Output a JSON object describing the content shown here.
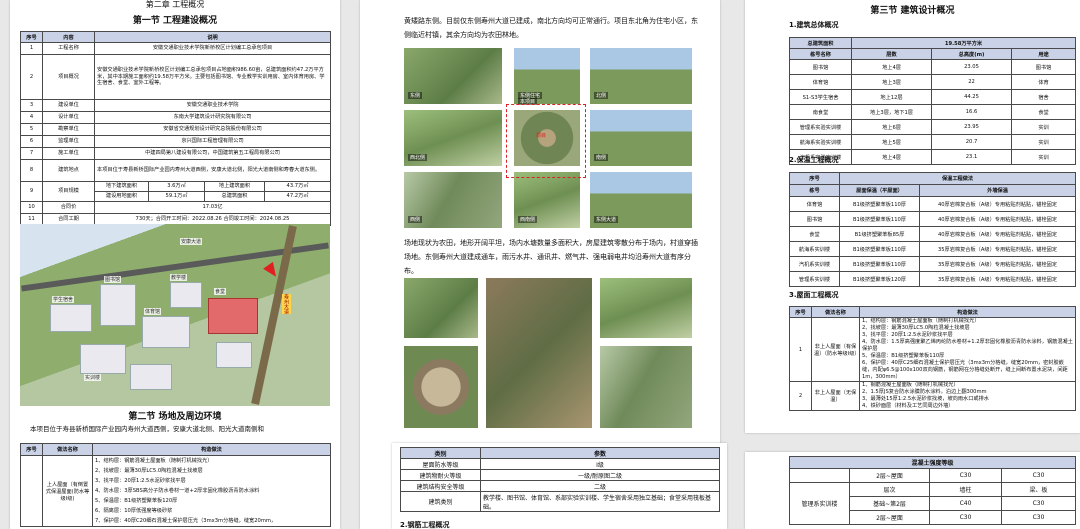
{
  "p1": {
    "chapter": "第二章 工程概况",
    "section1": "第一节 工程建设概况",
    "table_headers": [
      "序号",
      "内容",
      "说明"
    ],
    "rows": [
      [
        "1",
        "工程名称",
        "安徽交通职业技术学院新桥校区计划编工总承包项目"
      ],
      [
        "2",
        "项目概况",
        "安徽交通职业技术学院新桥校区计划编工总承包项目占地面积986.60亩，总建筑面积约47.2万平方米，其中本期施工面积约19.58万平方米。主要包括图书馆、专业教学实训用房、室内体育用房、学生宿舍、食堂、室外工程等。"
      ],
      [
        "3",
        "建设单位",
        "安徽交通职业技术学院"
      ],
      [
        "4",
        "设计单位",
        "东南大学建筑设计研究院有限公司"
      ],
      [
        "5",
        "勘察单位",
        "安徽省交通规划设计研究总院股份有限公司"
      ],
      [
        "6",
        "监理单位",
        "京兴国际工程管理有限公司"
      ],
      [
        "7",
        "施工单位",
        "中建四局第八建设有限公司，中国建筑第五工程局有限公司"
      ],
      [
        "8",
        "建筑地点",
        "本项目位于寿县新桥国际产业园内寿州大道西侧，安康大道北侧，阳光大道南侧和寿春大道东侧。"
      ]
    ],
    "area_row": {
      "no": "9",
      "label": "项目规模",
      "c1": "地下建筑面积",
      "v1": "3.6万㎡",
      "c2": "地上建筑面积",
      "v2": "43.7万㎡",
      "c3": "建设用地面积",
      "v3": "59.1万㎡",
      "c4": "总建筑面积",
      "v4": "47.2万㎡"
    },
    "row10": [
      "10",
      "合同价",
      "17.03亿"
    ],
    "row11": [
      "11",
      "合同工期",
      "730天；合同开工时间：2022.08.26 合同竣工时间：2024.08.25"
    ],
    "render_labels": [
      "安康大道",
      "寿州大道",
      "食堂",
      "图书馆",
      "体育馆",
      "学生宿舍",
      "实训楼",
      "教学楼"
    ],
    "section2": "第二节 场地及周边环境",
    "section2_text": "本项目位于寿县新桥国际产业园内寿州大道西侧，安康大道北侧、阳光大道南侧和",
    "bottom_table": {
      "headers": [
        "序号",
        "做法名称",
        "构造做法"
      ],
      "row_name": "上人屋面（有倒置式保温屋面(防水等级I级)",
      "steps": [
        "1、结构层：钢筋混凝土屋面板（随制打机械找光）",
        "2、找坡层：最薄30厚LC5.0陶粒混凝土找坡层",
        "3、找平层：20厚1:2.5水泥砂浆找平层",
        "4、防水层：3厚SBS高分子防水卷材一道+2厚非固化橡胶沥青防水涂料",
        "5、保温层：B1级挤塑聚苯板120厚",
        "6、隔离层：10厚低强度等级砂浆",
        "7、保护层：40厚C20细石混凝土保护层压光（3mx3m分格缝，缝宽20mm，"
      ]
    }
  },
  "p2": {
    "text_top": "黄矮路东侧。目前仅东侧寿州大道已建成，南北方向均可正常通行。项目东北角为住宅小区，东侧临近村镇，其余方向均为农田林地。",
    "photo_caps": [
      "东侧",
      "东侧住宅",
      "北侧",
      "西北侧",
      "本项目",
      "南侧",
      "西侧",
      "西南侧",
      "东侧大道"
    ],
    "center_label": "项目",
    "text_mid": "场地现状为农田，地形开阔平坦，场内水塘数量多面积大，房屋建筑零散分布于场内，村道穿插场地。东侧寿州大道建成通车，雨污水井、通讯井、燃气井、强电弱电井均沿寿州大道有序分布。"
  },
  "p5": {
    "headers": [
      "类别",
      "参数"
    ],
    "rows": [
      [
        "屋面防水等级",
        "I级"
      ],
      [
        "建筑物耐火等级",
        "一级/耐原图二级"
      ],
      [
        "建筑结构安全等级",
        "二级"
      ],
      [
        "建筑类别",
        "教学楼、图书馆、体育馆、系部实验实训楼、学生宿舍采用独立基础；食堂采用筏板基础。"
      ]
    ],
    "sub": "2.钢筋工程概况"
  },
  "p3": {
    "section": "第三节 建筑设计概况",
    "sub1": "1.建筑总体概况",
    "total_label": "总建筑面积",
    "total_value": "19.58万平方米",
    "overall_headers": [
      "栋号名称",
      "层数",
      "总高度(m)",
      "用途"
    ],
    "overall_rows": [
      [
        "图书馆",
        "地上4层",
        "23.05",
        "图书馆"
      ],
      [
        "体育馆",
        "地上3层",
        "22",
        "体育"
      ],
      [
        "S1-S3学生宿舍",
        "地上12层",
        "44.25",
        "宿舍"
      ],
      [
        "南食堂",
        "地上3层，地下1层",
        "16.6",
        "食堂"
      ],
      [
        "管理系实验实训楼",
        "地上6层",
        "23.95",
        "实训"
      ],
      [
        "航海系实验实训楼",
        "地上5层",
        "20.7",
        "实训"
      ],
      [
        "汽机系实验实训楼",
        "地上4层",
        "23.1",
        "实训"
      ]
    ],
    "sub2": "2.保温工程概况",
    "ins_headers": [
      "序号",
      "保温工程做法"
    ],
    "ins_sub_headers": [
      "栋号",
      "屋面保温（平屋面）",
      "外墙保温"
    ],
    "ins_rows": [
      [
        "体育馆",
        "B1级挤塑聚苯板110厚",
        "40厚岩棉复合板（A级）专用粘贴剂粘贴，锚栓固定"
      ],
      [
        "图书馆",
        "B1级挤塑聚苯板110厚",
        "40厚岩棉复合板（A级）专用粘贴剂粘贴，锚栓固定"
      ],
      [
        "食堂",
        "B1级挤塑聚苯板85厚",
        "40厚岩棉复合板（A级）专用粘贴剂粘贴，锚栓固定"
      ],
      [
        "航海系实训楼",
        "B1级挤塑聚苯板110厚",
        "35厚岩棉复合板（A级）专用粘贴剂粘贴，锚栓固定"
      ],
      [
        "汽机系实训楼",
        "B1级挤塑聚苯板110厚",
        "35厚岩棉复合板（A级）专用粘贴剂粘贴，锚栓固定"
      ],
      [
        "管理系实训楼",
        "B1级挤塑聚苯板120厚",
        "35厚岩棉复合板（A级）专用粘贴剂粘贴，锚栓固定"
      ]
    ],
    "sub3": "3.屋面工程概况",
    "roof_headers": [
      "序号",
      "做法名称",
      "构造做法"
    ],
    "roof1_no": "1",
    "roof1_name": "非上人屋面（有保温）（防水等级I级）",
    "roof1_steps": [
      "1、结构层：钢筋混凝土屋面板（随制打机械找光）",
      "2、找坡层：最薄30厚LC5.0陶粒混凝土找坡层",
      "3、找平层：20厚1:2.5水泥砂浆找平层",
      "4、防水层：1.5厚高强度聚乙烯丙纶防水卷材+1.2厚非固化橡胶沥青防水涂料，钢筋混凝土保护层",
      "5、保温层：B1级挤塑聚苯板110厚",
      "6、保护层：40厚C25细石混凝土保护层压光（3mx3m分格缝，缝宽20mm，密封胶嵌缝，内配φ6.5@100x100双向钢筋，钢筋网在分格缝处断开，缝上间断布置水泥块，间距1m，300mm）"
    ],
    "roof2_no": "2",
    "roof2_name": "非上人屋面（无保温）",
    "roof2_steps": [
      "1、钢筋混凝土屋面板（随制打机械找光）",
      "2、1.5厚JS复合防水涂膜防水涂料，泊边上翻300mm",
      "3、最薄处15厚1:2.5水泥砂浆找坡，坡向雨水口或排水",
      "4、铁砂面层（材料及工艺同周边外墙）"
    ]
  },
  "p4": {
    "header": "混凝土强度等级",
    "row1": [
      "2层~屋面",
      "C30",
      "C30"
    ],
    "row2_label": "管理系实训楼",
    "row2": [
      "层次",
      "墙柱",
      "梁、板"
    ],
    "row3": [
      "基础~第2层",
      "C40",
      "C30"
    ],
    "row4": [
      "2层~屋面",
      "C30",
      "C30"
    ]
  }
}
